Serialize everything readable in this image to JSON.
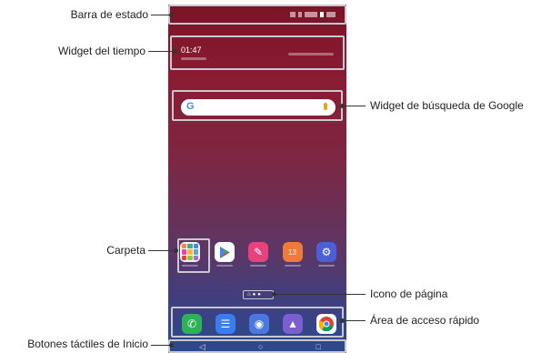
{
  "callouts": {
    "status_bar": "Barra de estado",
    "weather_widget": "Widget del tiempo",
    "google_widget": "Widget de búsqueda de Google",
    "folder": "Carpeta",
    "page_icon": "Icono de página",
    "quick_access": "Área de acceso rápido",
    "home_buttons": "Botones táctiles de Inicio"
  },
  "weather": {
    "time": "01:47"
  },
  "google": {
    "logo": "G"
  },
  "apps": [
    {
      "icon": "play-store-icon",
      "color": "#ffffff"
    },
    {
      "icon": "quickmemo-icon",
      "color": "#e8427c"
    },
    {
      "icon": "calendar-icon",
      "color": "#f07a3a",
      "text": "13"
    },
    {
      "icon": "settings-icon",
      "color": "#4a5fd8"
    }
  ],
  "dock": [
    {
      "icon": "phone-icon",
      "color": "#2fb257"
    },
    {
      "icon": "messages-icon",
      "color": "#3a7df0"
    },
    {
      "icon": "camera-icon",
      "color": "#4a78e0"
    },
    {
      "icon": "gallery-icon",
      "color": "#7b5fd0"
    },
    {
      "icon": "chrome-icon",
      "color": "#ffffff"
    }
  ],
  "nav": {
    "back": "◁",
    "home": "○",
    "recents": "□"
  },
  "colors": {
    "outline": "#c8c8d0",
    "leader": "#333333"
  }
}
